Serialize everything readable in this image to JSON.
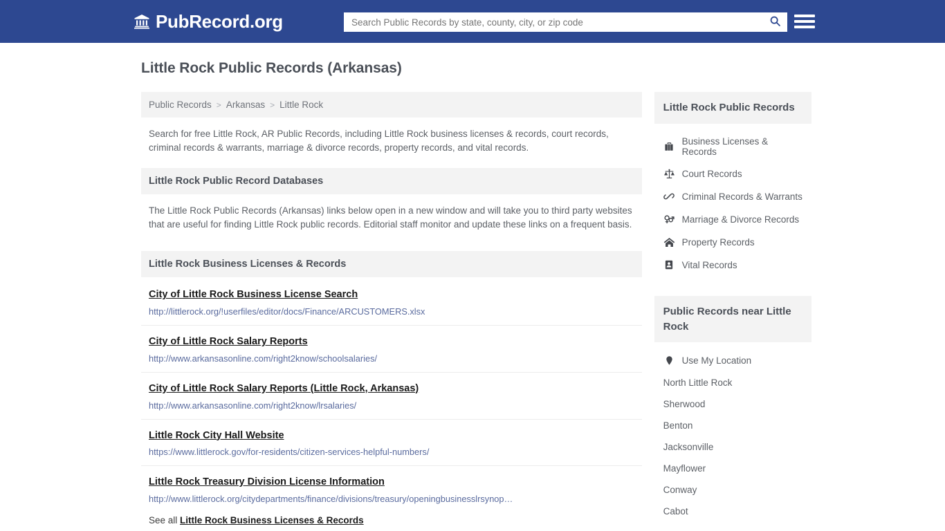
{
  "colors": {
    "header_blue": "#2d4891",
    "section_gray": "#f3f3f3",
    "url_link": "#5a6b9e",
    "title_text": "#4a4f57"
  },
  "header": {
    "logo_text": "PubRecord.org",
    "logo_icon": "bank-building-icon",
    "search": {
      "placeholder": "Search Public Records by state, county, city, or zip code",
      "value": "",
      "search_icon": "search-icon"
    },
    "menu_icon": "hamburger-menu-icon"
  },
  "page": {
    "title": "Little Rock Public Records (Arkansas)",
    "breadcrumb": [
      {
        "label": "Public Records",
        "current": false
      },
      {
        "label": "Arkansas",
        "current": false
      },
      {
        "label": "Little Rock",
        "current": true
      }
    ],
    "breadcrumb_separator": ">",
    "intro": "Search for free Little Rock, AR Public Records, including Little Rock business licenses & records, court records, criminal records & warrants, marriage & divorce records, property records, and vital records.",
    "databases_section": {
      "heading": "Little Rock Public Record Databases",
      "body": "The Little Rock Public Records (Arkansas) links below open in a new window and will take you to third party websites that are useful for finding Little Rock public records. Editorial staff monitor and update these links on a frequent basis."
    },
    "licenses_section": {
      "heading": "Little Rock Business Licenses & Records",
      "links": [
        {
          "title": "City of Little Rock Business License Search",
          "url": "http://littlerock.org/!userfiles/editor/docs/Finance/ARCUSTOMERS.xlsx"
        },
        {
          "title": "City of Little Rock Salary Reports",
          "url": "http://www.arkansasonline.com/right2know/schoolsalaries/"
        },
        {
          "title": "City of Little Rock Salary Reports (Little Rock, Arkansas)",
          "url": "http://www.arkansasonline.com/right2know/lrsalaries/"
        },
        {
          "title": "Little Rock City Hall Website",
          "url": "https://www.littlerock.gov/for-residents/citizen-services-helpful-numbers/"
        },
        {
          "title": "Little Rock Treasury Division License Information",
          "url": "http://www.littlerock.org/citydepartments/finance/divisions/treasury/openingbusinesslrsynop…"
        }
      ],
      "see_all_prefix": "See all",
      "see_all_link": "Little Rock Business Licenses & Records"
    }
  },
  "sidebar": {
    "records_block": {
      "heading": "Little Rock Public Records",
      "items": [
        {
          "label": "Business Licenses & Records",
          "icon": "briefcase-icon"
        },
        {
          "label": "Court Records",
          "icon": "balance-scale-icon"
        },
        {
          "label": "Criminal Records & Warrants",
          "icon": "handcuffs-icon"
        },
        {
          "label": "Marriage & Divorce Records",
          "icon": "venus-mars-icon"
        },
        {
          "label": "Property Records",
          "icon": "home-icon"
        },
        {
          "label": "Vital Records",
          "icon": "id-card-icon"
        }
      ]
    },
    "nearby_block": {
      "heading": "Public Records near Little Rock",
      "items": [
        {
          "label": "Use My Location",
          "icon": "map-pin-icon"
        },
        {
          "label": "North Little Rock",
          "icon": ""
        },
        {
          "label": "Sherwood",
          "icon": ""
        },
        {
          "label": "Benton",
          "icon": ""
        },
        {
          "label": "Jacksonville",
          "icon": ""
        },
        {
          "label": "Mayflower",
          "icon": ""
        },
        {
          "label": "Conway",
          "icon": ""
        },
        {
          "label": "Cabot",
          "icon": ""
        }
      ]
    }
  }
}
